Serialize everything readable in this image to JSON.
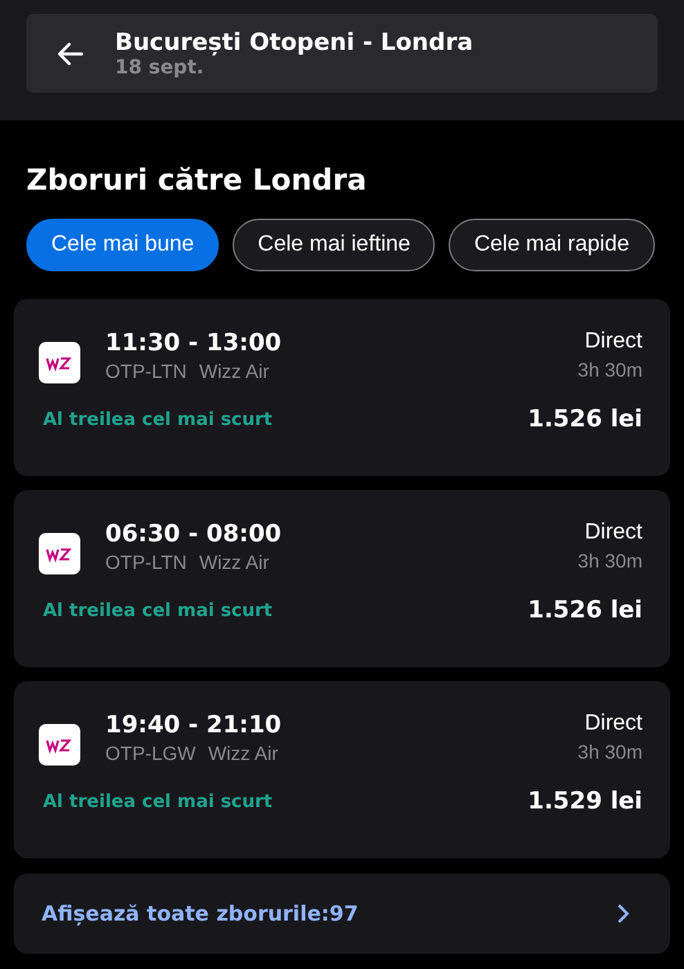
{
  "header": {
    "title": "București Otopeni - Londra",
    "date": "18 sept."
  },
  "heading": "Zboruri către Londra",
  "filters": [
    {
      "label": "Cele mai bune",
      "selected": true
    },
    {
      "label": "Cele mai ieftine",
      "selected": false
    },
    {
      "label": "Cele mai rapide",
      "selected": false
    }
  ],
  "flights": [
    {
      "times": "11:30 - 13:00",
      "route": "OTP-LTN",
      "airline": "Wizz Air",
      "stops": "Direct",
      "duration": "3h 30m",
      "tag": "Al treilea cel mai scurt",
      "price": "1.526 lei"
    },
    {
      "times": "06:30 - 08:00",
      "route": "OTP-LTN",
      "airline": "Wizz Air",
      "stops": "Direct",
      "duration": "3h 30m",
      "tag": "Al treilea cel mai scurt",
      "price": "1.526 lei"
    },
    {
      "times": "19:40 - 21:10",
      "route": "OTP-LGW",
      "airline": "Wizz Air",
      "stops": "Direct",
      "duration": "3h 30m",
      "tag": "Al treilea cel mai scurt",
      "price": "1.529 lei"
    }
  ],
  "show_all": "Afișează toate zborurile:97"
}
